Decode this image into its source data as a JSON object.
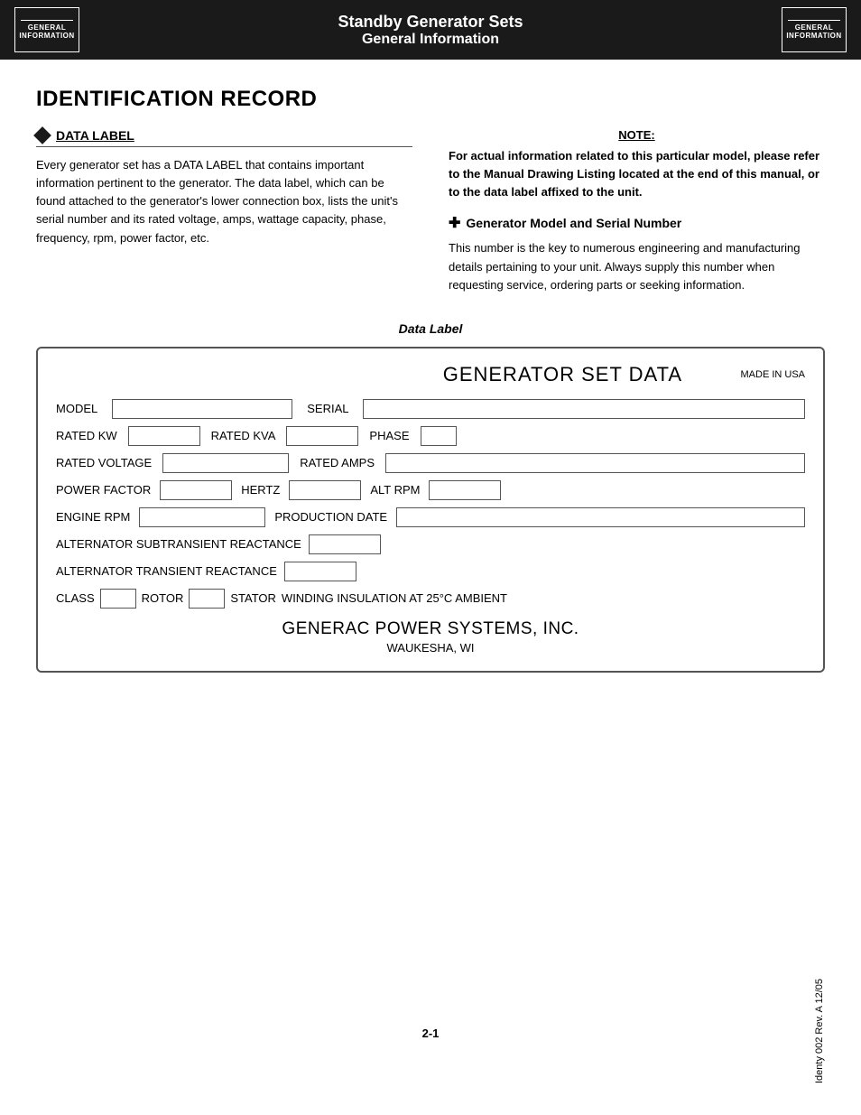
{
  "header": {
    "logo_line1": "GENERAL",
    "logo_line2": "INFORMATION",
    "title_line1": "Standby Generator Sets",
    "title_line2": "General Information"
  },
  "identification": {
    "main_title": "IDENTIFICATION RECORD",
    "data_label_section": {
      "heading": "DATA LABEL",
      "text": "Every generator set has a DATA LABEL that contains important information pertinent to the generator. The data label, which can be found attached to the generator's lower connection box, lists the unit's serial number and its rated voltage, amps, wattage capacity, phase, frequency, rpm, power factor, etc."
    },
    "note_section": {
      "note_label": "NOTE:",
      "note_text": "For actual information related to this particular model, please refer to the Manual Drawing Listing located at the end of this manual, or to the data label affixed to the unit.",
      "sub_heading": "Generator Model and Serial Number",
      "sub_text": "This number is the key to numerous engineering and manufacturing details pertaining to your unit. Always supply this number when requesting service, ordering parts or seeking information."
    }
  },
  "data_label_diagram": {
    "caption": "Data Label",
    "generator_set_data": {
      "title": "GENERATOR SET DATA",
      "made_in_usa": "MADE IN USA",
      "fields": {
        "model_label": "MODEL",
        "serial_label": "SERIAL",
        "rated_kw_label": "RATED KW",
        "rated_kva_label": "RATED KVA",
        "phase_label": "PHASE",
        "rated_voltage_label": "RATED VOLTAGE",
        "rated_amps_label": "RATED AMPS",
        "power_factor_label": "POWER FACTOR",
        "hertz_label": "HERTZ",
        "alt_rpm_label": "ALT RPM",
        "engine_rpm_label": "ENGINE RPM",
        "production_date_label": "PRODUCTION DATE",
        "alt_subtransient_label": "ALTERNATOR SUBTRANSIENT REACTANCE",
        "alt_transient_label": "ALTERNATOR TRANSIENT REACTANCE",
        "class_label": "CLASS",
        "rotor_label": "ROTOR",
        "stator_label": "STATOR",
        "winding_label": "WINDING INSULATION AT 25°C AMBIENT"
      },
      "company_name": "GENERAC POWER SYSTEMS, INC.",
      "company_location": "WAUKESHA, WI"
    }
  },
  "footer": {
    "page_number": "2-1",
    "doc_ref": "Identy 002 Rev. A 12/05"
  }
}
